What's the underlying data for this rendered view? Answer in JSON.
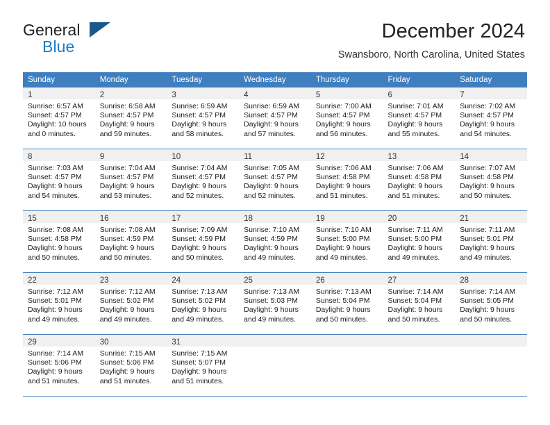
{
  "brand": {
    "name_part1": "General",
    "name_part2": "Blue",
    "flag_icon": "triangle-flag-icon",
    "accent_color": "#1c7cc4",
    "flag_color": "#19588f"
  },
  "header": {
    "month_title": "December 2024",
    "location": "Swansboro, North Carolina, United States"
  },
  "calendar": {
    "header_bg": "#3f7fbf",
    "daynum_bg": "#f0f0f0",
    "weekday_headers": [
      "Sunday",
      "Monday",
      "Tuesday",
      "Wednesday",
      "Thursday",
      "Friday",
      "Saturday"
    ],
    "weeks": [
      [
        {
          "day": "1",
          "sunrise": "Sunrise: 6:57 AM",
          "sunset": "Sunset: 4:57 PM",
          "daylight_line1": "Daylight: 10 hours",
          "daylight_line2": "and 0 minutes."
        },
        {
          "day": "2",
          "sunrise": "Sunrise: 6:58 AM",
          "sunset": "Sunset: 4:57 PM",
          "daylight_line1": "Daylight: 9 hours",
          "daylight_line2": "and 59 minutes."
        },
        {
          "day": "3",
          "sunrise": "Sunrise: 6:59 AM",
          "sunset": "Sunset: 4:57 PM",
          "daylight_line1": "Daylight: 9 hours",
          "daylight_line2": "and 58 minutes."
        },
        {
          "day": "4",
          "sunrise": "Sunrise: 6:59 AM",
          "sunset": "Sunset: 4:57 PM",
          "daylight_line1": "Daylight: 9 hours",
          "daylight_line2": "and 57 minutes."
        },
        {
          "day": "5",
          "sunrise": "Sunrise: 7:00 AM",
          "sunset": "Sunset: 4:57 PM",
          "daylight_line1": "Daylight: 9 hours",
          "daylight_line2": "and 56 minutes."
        },
        {
          "day": "6",
          "sunrise": "Sunrise: 7:01 AM",
          "sunset": "Sunset: 4:57 PM",
          "daylight_line1": "Daylight: 9 hours",
          "daylight_line2": "and 55 minutes."
        },
        {
          "day": "7",
          "sunrise": "Sunrise: 7:02 AM",
          "sunset": "Sunset: 4:57 PM",
          "daylight_line1": "Daylight: 9 hours",
          "daylight_line2": "and 54 minutes."
        }
      ],
      [
        {
          "day": "8",
          "sunrise": "Sunrise: 7:03 AM",
          "sunset": "Sunset: 4:57 PM",
          "daylight_line1": "Daylight: 9 hours",
          "daylight_line2": "and 54 minutes."
        },
        {
          "day": "9",
          "sunrise": "Sunrise: 7:04 AM",
          "sunset": "Sunset: 4:57 PM",
          "daylight_line1": "Daylight: 9 hours",
          "daylight_line2": "and 53 minutes."
        },
        {
          "day": "10",
          "sunrise": "Sunrise: 7:04 AM",
          "sunset": "Sunset: 4:57 PM",
          "daylight_line1": "Daylight: 9 hours",
          "daylight_line2": "and 52 minutes."
        },
        {
          "day": "11",
          "sunrise": "Sunrise: 7:05 AM",
          "sunset": "Sunset: 4:57 PM",
          "daylight_line1": "Daylight: 9 hours",
          "daylight_line2": "and 52 minutes."
        },
        {
          "day": "12",
          "sunrise": "Sunrise: 7:06 AM",
          "sunset": "Sunset: 4:58 PM",
          "daylight_line1": "Daylight: 9 hours",
          "daylight_line2": "and 51 minutes."
        },
        {
          "day": "13",
          "sunrise": "Sunrise: 7:06 AM",
          "sunset": "Sunset: 4:58 PM",
          "daylight_line1": "Daylight: 9 hours",
          "daylight_line2": "and 51 minutes."
        },
        {
          "day": "14",
          "sunrise": "Sunrise: 7:07 AM",
          "sunset": "Sunset: 4:58 PM",
          "daylight_line1": "Daylight: 9 hours",
          "daylight_line2": "and 50 minutes."
        }
      ],
      [
        {
          "day": "15",
          "sunrise": "Sunrise: 7:08 AM",
          "sunset": "Sunset: 4:58 PM",
          "daylight_line1": "Daylight: 9 hours",
          "daylight_line2": "and 50 minutes."
        },
        {
          "day": "16",
          "sunrise": "Sunrise: 7:08 AM",
          "sunset": "Sunset: 4:59 PM",
          "daylight_line1": "Daylight: 9 hours",
          "daylight_line2": "and 50 minutes."
        },
        {
          "day": "17",
          "sunrise": "Sunrise: 7:09 AM",
          "sunset": "Sunset: 4:59 PM",
          "daylight_line1": "Daylight: 9 hours",
          "daylight_line2": "and 50 minutes."
        },
        {
          "day": "18",
          "sunrise": "Sunrise: 7:10 AM",
          "sunset": "Sunset: 4:59 PM",
          "daylight_line1": "Daylight: 9 hours",
          "daylight_line2": "and 49 minutes."
        },
        {
          "day": "19",
          "sunrise": "Sunrise: 7:10 AM",
          "sunset": "Sunset: 5:00 PM",
          "daylight_line1": "Daylight: 9 hours",
          "daylight_line2": "and 49 minutes."
        },
        {
          "day": "20",
          "sunrise": "Sunrise: 7:11 AM",
          "sunset": "Sunset: 5:00 PM",
          "daylight_line1": "Daylight: 9 hours",
          "daylight_line2": "and 49 minutes."
        },
        {
          "day": "21",
          "sunrise": "Sunrise: 7:11 AM",
          "sunset": "Sunset: 5:01 PM",
          "daylight_line1": "Daylight: 9 hours",
          "daylight_line2": "and 49 minutes."
        }
      ],
      [
        {
          "day": "22",
          "sunrise": "Sunrise: 7:12 AM",
          "sunset": "Sunset: 5:01 PM",
          "daylight_line1": "Daylight: 9 hours",
          "daylight_line2": "and 49 minutes."
        },
        {
          "day": "23",
          "sunrise": "Sunrise: 7:12 AM",
          "sunset": "Sunset: 5:02 PM",
          "daylight_line1": "Daylight: 9 hours",
          "daylight_line2": "and 49 minutes."
        },
        {
          "day": "24",
          "sunrise": "Sunrise: 7:13 AM",
          "sunset": "Sunset: 5:02 PM",
          "daylight_line1": "Daylight: 9 hours",
          "daylight_line2": "and 49 minutes."
        },
        {
          "day": "25",
          "sunrise": "Sunrise: 7:13 AM",
          "sunset": "Sunset: 5:03 PM",
          "daylight_line1": "Daylight: 9 hours",
          "daylight_line2": "and 49 minutes."
        },
        {
          "day": "26",
          "sunrise": "Sunrise: 7:13 AM",
          "sunset": "Sunset: 5:04 PM",
          "daylight_line1": "Daylight: 9 hours",
          "daylight_line2": "and 50 minutes."
        },
        {
          "day": "27",
          "sunrise": "Sunrise: 7:14 AM",
          "sunset": "Sunset: 5:04 PM",
          "daylight_line1": "Daylight: 9 hours",
          "daylight_line2": "and 50 minutes."
        },
        {
          "day": "28",
          "sunrise": "Sunrise: 7:14 AM",
          "sunset": "Sunset: 5:05 PM",
          "daylight_line1": "Daylight: 9 hours",
          "daylight_line2": "and 50 minutes."
        }
      ],
      [
        {
          "day": "29",
          "sunrise": "Sunrise: 7:14 AM",
          "sunset": "Sunset: 5:06 PM",
          "daylight_line1": "Daylight: 9 hours",
          "daylight_line2": "and 51 minutes."
        },
        {
          "day": "30",
          "sunrise": "Sunrise: 7:15 AM",
          "sunset": "Sunset: 5:06 PM",
          "daylight_line1": "Daylight: 9 hours",
          "daylight_line2": "and 51 minutes."
        },
        {
          "day": "31",
          "sunrise": "Sunrise: 7:15 AM",
          "sunset": "Sunset: 5:07 PM",
          "daylight_line1": "Daylight: 9 hours",
          "daylight_line2": "and 51 minutes."
        },
        {
          "day": "",
          "sunrise": "",
          "sunset": "",
          "daylight_line1": "",
          "daylight_line2": ""
        },
        {
          "day": "",
          "sunrise": "",
          "sunset": "",
          "daylight_line1": "",
          "daylight_line2": ""
        },
        {
          "day": "",
          "sunrise": "",
          "sunset": "",
          "daylight_line1": "",
          "daylight_line2": ""
        },
        {
          "day": "",
          "sunrise": "",
          "sunset": "",
          "daylight_line1": "",
          "daylight_line2": ""
        }
      ]
    ]
  }
}
